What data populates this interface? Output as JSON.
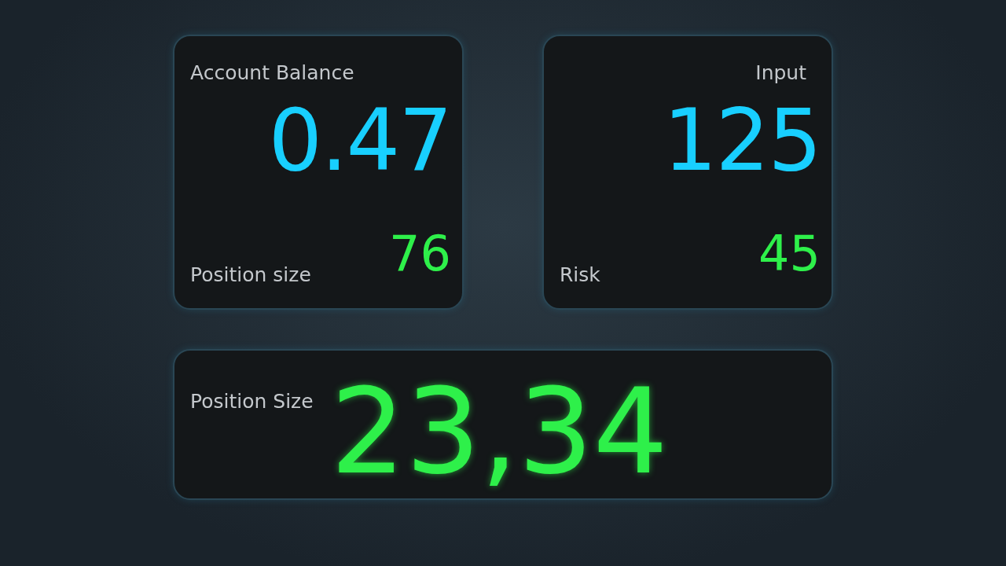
{
  "cards": [
    {
      "title": "Account Balance",
      "kind": "balance",
      "value": "0.47",
      "sub_label": "Position size",
      "sub_value": "76"
    },
    {
      "title": "Input",
      "kind": "input",
      "value": "125",
      "sub_label": "Risk",
      "sub_value": "45"
    }
  ],
  "result": {
    "label": "Position Size",
    "value": "23,34"
  }
}
